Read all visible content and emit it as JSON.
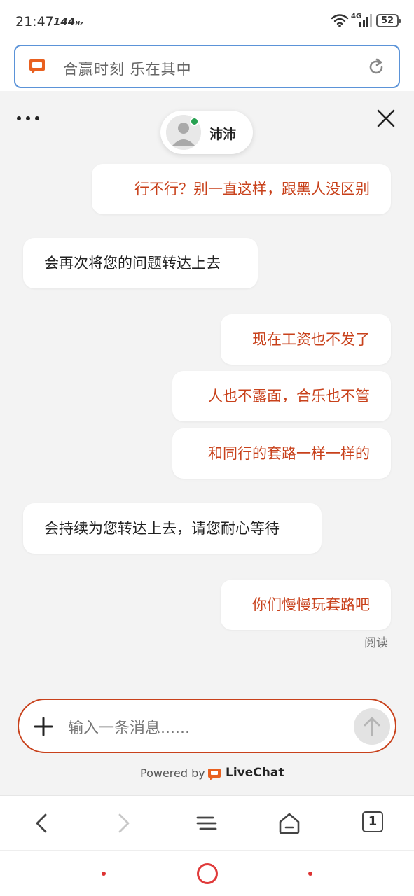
{
  "status": {
    "time": "21:47",
    "refresh": "144",
    "refresh_unit": "Hz",
    "network": "4G",
    "battery": "52"
  },
  "urlbar": {
    "title": "合赢时刻 乐在其中"
  },
  "agent": {
    "name": "沛沛"
  },
  "messages": [
    {
      "side": "out",
      "text": "行不行？别一直这样，跟黑人没区别"
    },
    {
      "side": "in",
      "text": "会再次将您的问题转达上去"
    },
    {
      "side": "out",
      "text": "现在工资也不发了"
    },
    {
      "side": "out",
      "text": "人也不露面，合乐也不管"
    },
    {
      "side": "out",
      "text": "和同行的套路一样一样的"
    },
    {
      "side": "in",
      "text": "会持续为您转达上去，请您耐心等待"
    },
    {
      "side": "out",
      "text": "你们慢慢玩套路吧"
    }
  ],
  "read_status": "阅读",
  "composer": {
    "placeholder": "输入一条消息......"
  },
  "powered": {
    "prefix": "Powered by",
    "brand": "LiveChat"
  },
  "tabs": {
    "count": "1"
  },
  "colors": {
    "accent": "#c8411b",
    "url_border": "#5b93d8",
    "online": "#27a151"
  }
}
